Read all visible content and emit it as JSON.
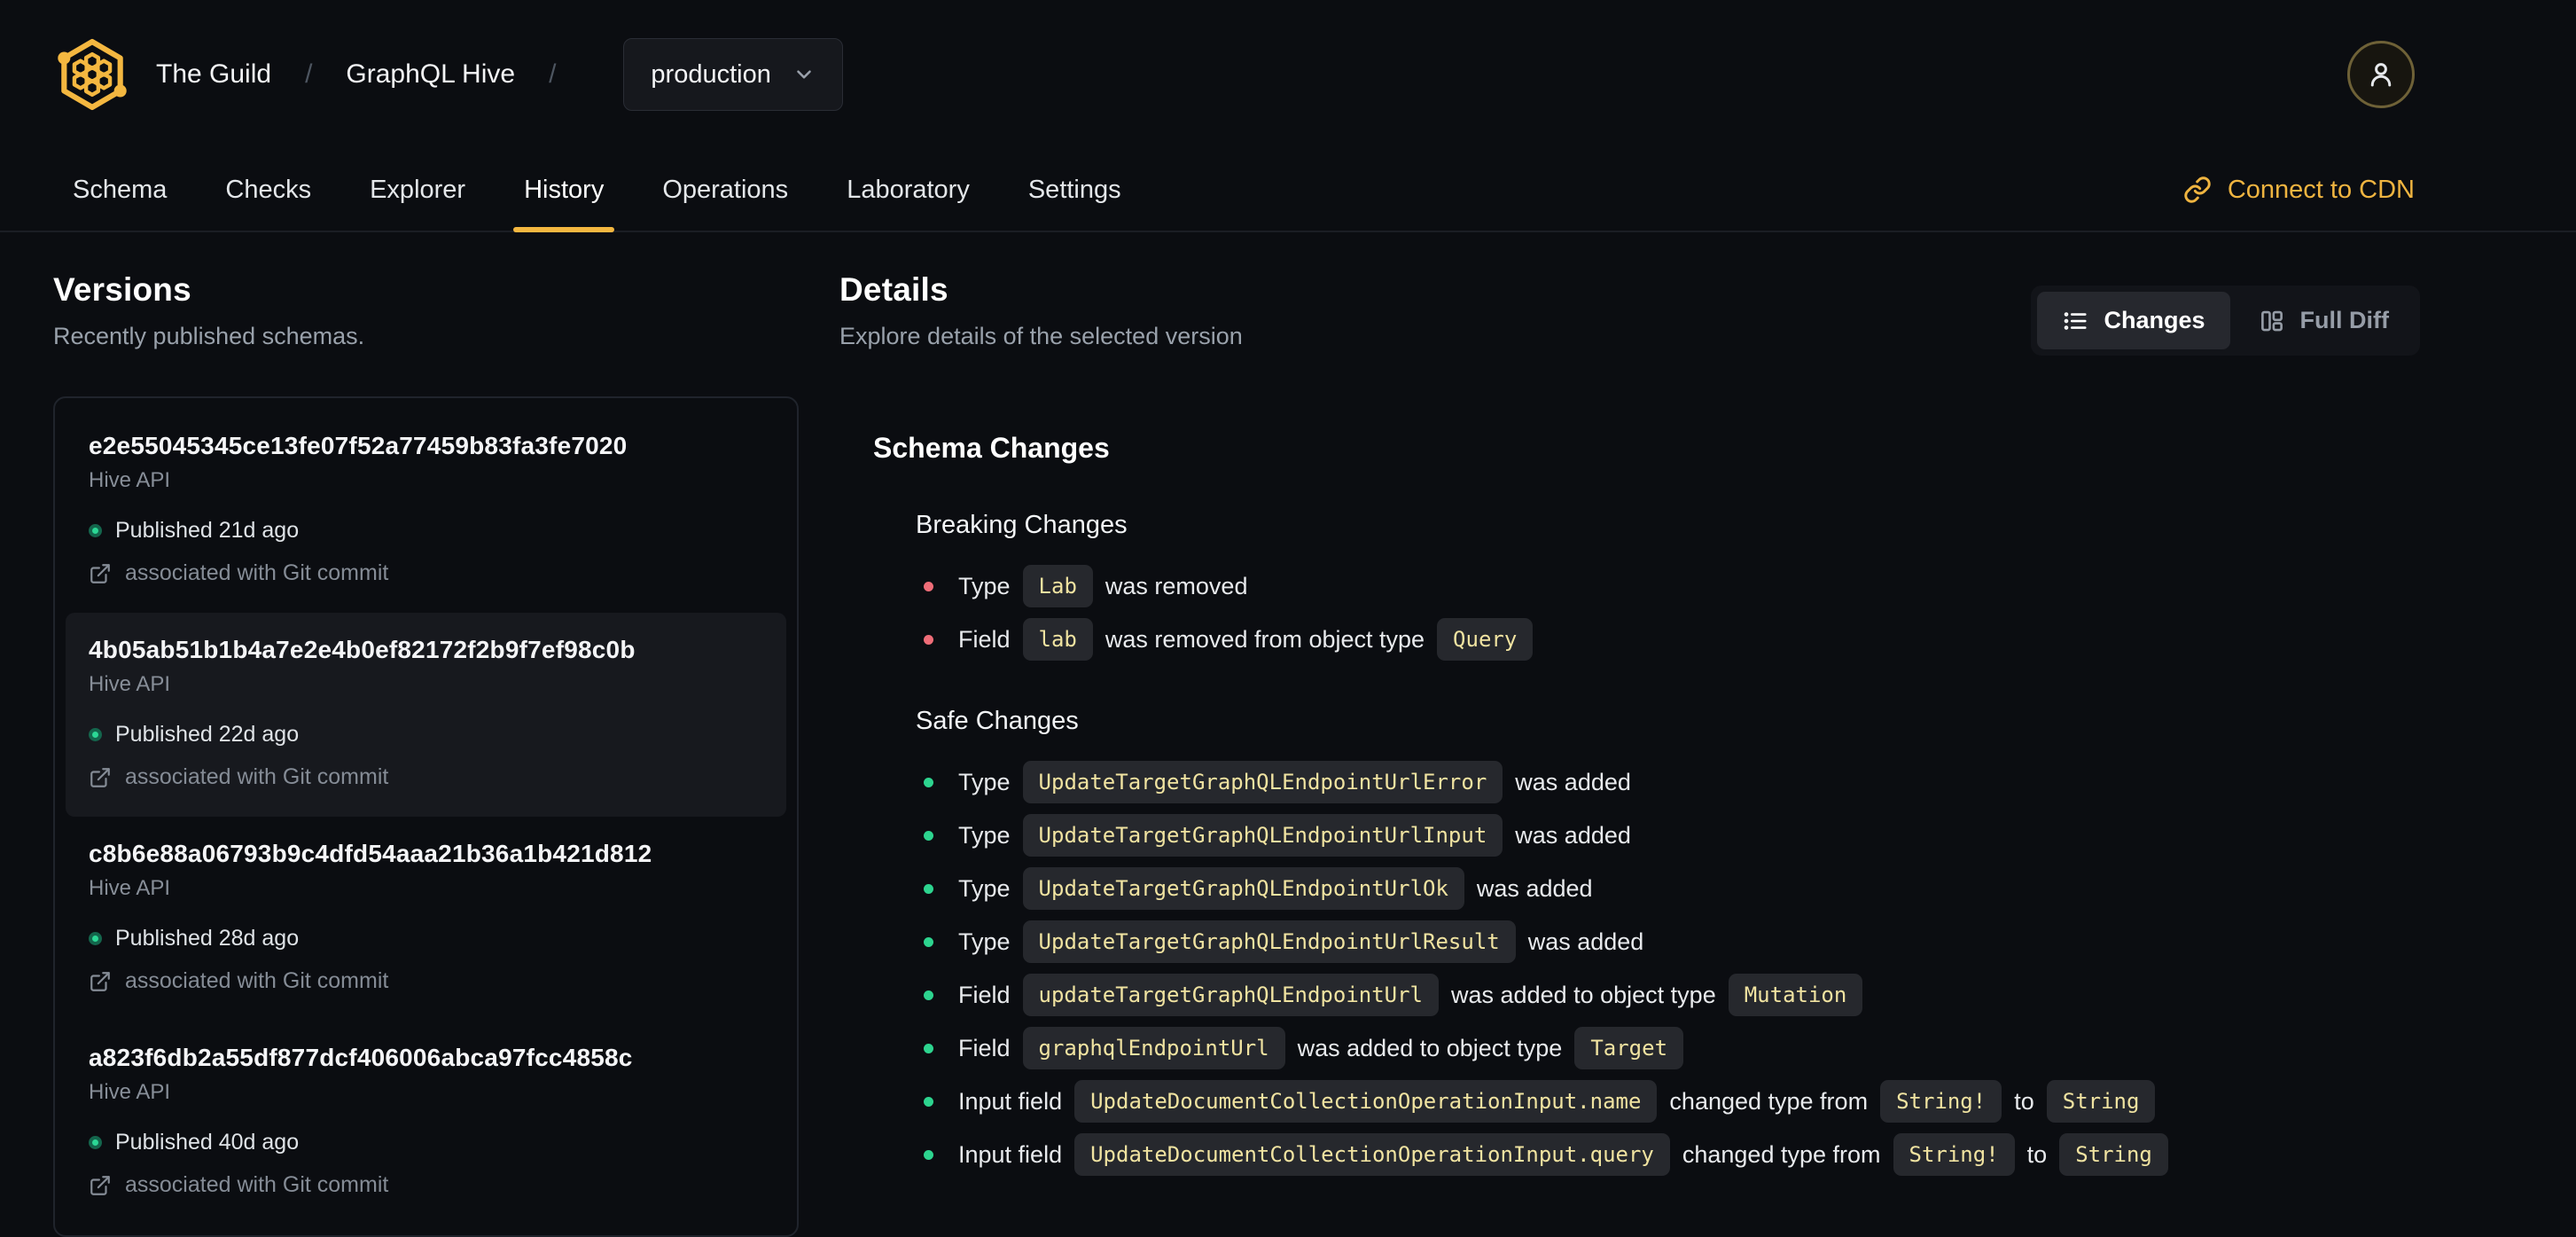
{
  "header": {
    "breadcrumb": {
      "org": "The Guild",
      "separator": "/",
      "project": "GraphQL Hive",
      "target": "production"
    },
    "tabs": [
      {
        "label": "Schema",
        "active": false
      },
      {
        "label": "Checks",
        "active": false
      },
      {
        "label": "Explorer",
        "active": false
      },
      {
        "label": "History",
        "active": true
      },
      {
        "label": "Operations",
        "active": false
      },
      {
        "label": "Laboratory",
        "active": false
      },
      {
        "label": "Settings",
        "active": false
      }
    ],
    "connect_cdn_label": "Connect to CDN"
  },
  "icons": {
    "logo": "hive-hexagon-icon",
    "target_chevron": "chevron-down-icon",
    "avatar": "person-icon",
    "cdn": "link-icon",
    "changes_view": "list-icon",
    "full_diff_view": "columns-icon",
    "git": "external-link-icon",
    "published": "status-dot"
  },
  "versions": {
    "title": "Versions",
    "subtitle": "Recently published schemas.",
    "items": [
      {
        "hash": "e2e55045345ce13fe07f52a77459b83fa3fe7020",
        "service": "Hive API",
        "status": "Published 21d ago",
        "git": "associated with Git commit",
        "selected": false
      },
      {
        "hash": "4b05ab51b1b4a7e2e4b0ef82172f2b9f7ef98c0b",
        "service": "Hive API",
        "status": "Published 22d ago",
        "git": "associated with Git commit",
        "selected": true
      },
      {
        "hash": "c8b6e88a06793b9c4dfd54aaa21b36a1b421d812",
        "service": "Hive API",
        "status": "Published 28d ago",
        "git": "associated with Git commit",
        "selected": false
      },
      {
        "hash": "a823f6db2a55df877dcf406006abca97fcc4858c",
        "service": "Hive API",
        "status": "Published 40d ago",
        "git": "associated with Git commit",
        "selected": false
      }
    ]
  },
  "details": {
    "title": "Details",
    "subtitle": "Explore details of the selected version",
    "view_toggle": {
      "changes": "Changes",
      "full_diff": "Full Diff"
    },
    "schema_changes_title": "Schema Changes",
    "groups": [
      {
        "title": "Breaking Changes",
        "severity": "breaking",
        "items": [
          [
            {
              "t": "text",
              "v": "Type"
            },
            {
              "t": "code",
              "v": "Lab"
            },
            {
              "t": "text",
              "v": "was removed"
            }
          ],
          [
            {
              "t": "text",
              "v": "Field"
            },
            {
              "t": "code",
              "v": "lab"
            },
            {
              "t": "text",
              "v": "was removed from object type"
            },
            {
              "t": "code",
              "v": "Query"
            }
          ]
        ]
      },
      {
        "title": "Safe Changes",
        "severity": "safe",
        "items": [
          [
            {
              "t": "text",
              "v": "Type"
            },
            {
              "t": "code",
              "v": "UpdateTargetGraphQLEndpointUrlError"
            },
            {
              "t": "text",
              "v": "was added"
            }
          ],
          [
            {
              "t": "text",
              "v": "Type"
            },
            {
              "t": "code",
              "v": "UpdateTargetGraphQLEndpointUrlInput"
            },
            {
              "t": "text",
              "v": "was added"
            }
          ],
          [
            {
              "t": "text",
              "v": "Type"
            },
            {
              "t": "code",
              "v": "UpdateTargetGraphQLEndpointUrlOk"
            },
            {
              "t": "text",
              "v": "was added"
            }
          ],
          [
            {
              "t": "text",
              "v": "Type"
            },
            {
              "t": "code",
              "v": "UpdateTargetGraphQLEndpointUrlResult"
            },
            {
              "t": "text",
              "v": "was added"
            }
          ],
          [
            {
              "t": "text",
              "v": "Field"
            },
            {
              "t": "code",
              "v": "updateTargetGraphQLEndpointUrl"
            },
            {
              "t": "text",
              "v": "was added to object type"
            },
            {
              "t": "code",
              "v": "Mutation"
            }
          ],
          [
            {
              "t": "text",
              "v": "Field"
            },
            {
              "t": "code",
              "v": "graphqlEndpointUrl"
            },
            {
              "t": "text",
              "v": "was added to object type"
            },
            {
              "t": "code",
              "v": "Target"
            }
          ],
          [
            {
              "t": "text",
              "v": "Input field"
            },
            {
              "t": "code",
              "v": "UpdateDocumentCollectionOperationInput.name"
            },
            {
              "t": "text",
              "v": "changed type from"
            },
            {
              "t": "code",
              "v": "String!"
            },
            {
              "t": "text",
              "v": "to"
            },
            {
              "t": "code",
              "v": "String"
            }
          ],
          [
            {
              "t": "text",
              "v": "Input field"
            },
            {
              "t": "code",
              "v": "UpdateDocumentCollectionOperationInput.query"
            },
            {
              "t": "text",
              "v": "changed type from"
            },
            {
              "t": "code",
              "v": "String!"
            },
            {
              "t": "text",
              "v": "to"
            },
            {
              "t": "code",
              "v": "String"
            }
          ]
        ]
      }
    ]
  },
  "colors": {
    "accent_gold": "#f4b740",
    "breaking_bullet": "#ef6d78",
    "safe_bullet": "#2dd48f",
    "published_dot": "#2bd795",
    "code_chip_text": "#f0e3a1",
    "code_chip_bg": "#26282d",
    "page_bg": "#0b0d11",
    "selected_card_bg": "#17191e"
  }
}
